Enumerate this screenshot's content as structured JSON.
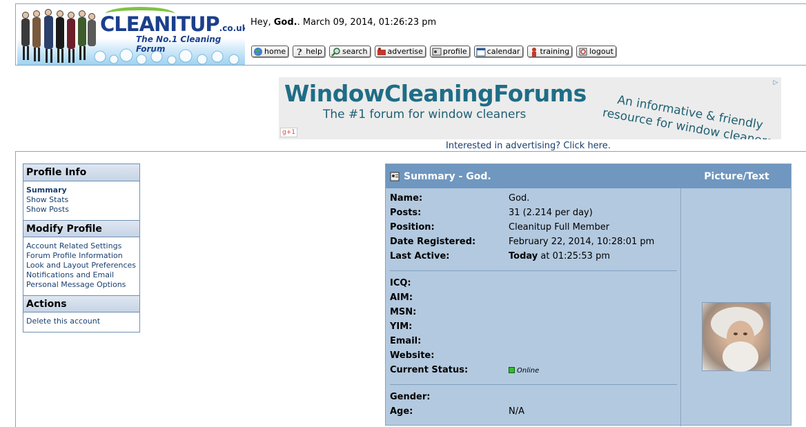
{
  "header": {
    "brand": "CLEANITUP",
    "brand_tld": ".co.uk",
    "tagline": "The No.1 Cleaning Forum",
    "greeting_prefix": "Hey, ",
    "username": "God.",
    "greeting_suffix": ". March 09, 2014, 01:26:23 pm"
  },
  "nav": [
    {
      "label": "home",
      "icon": "globe-icon"
    },
    {
      "label": "help",
      "icon": "question-icon"
    },
    {
      "label": "search",
      "icon": "magnifier-icon"
    },
    {
      "label": "advertise",
      "icon": "advertise-icon"
    },
    {
      "label": "profile",
      "icon": "profile-icon"
    },
    {
      "label": "calendar",
      "icon": "calendar-icon"
    },
    {
      "label": "training",
      "icon": "training-icon"
    },
    {
      "label": "logout",
      "icon": "logout-icon"
    }
  ],
  "ad": {
    "title": "WindowCleaningForums",
    "subtitle": "The #1 forum for window cleaners",
    "tagline": "An informative & friendly resource for window cleaners",
    "gplus": "g+1",
    "link": "Interested in advertising? Click here."
  },
  "menu": {
    "profile_info": {
      "title": "Profile Info",
      "items": [
        "Summary",
        "Show Stats",
        "Show Posts"
      ]
    },
    "modify_profile": {
      "title": "Modify Profile",
      "items": [
        "Account Related Settings",
        "Forum Profile Information",
        "Look and Layout Preferences",
        "Notifications and Email",
        "Personal Message Options"
      ]
    },
    "actions": {
      "title": "Actions",
      "items": [
        "Delete this account"
      ]
    }
  },
  "summary": {
    "title": "Summary - God.",
    "picture_header": "Picture/Text",
    "rows": {
      "name": {
        "label": "Name:",
        "value": "God."
      },
      "posts": {
        "label": "Posts:",
        "value": "31 (2.214 per day)"
      },
      "position": {
        "label": "Position:",
        "value": "Cleanitup Full Member"
      },
      "registered": {
        "label": "Date Registered:",
        "value": "February 22, 2014, 10:28:01 pm"
      },
      "last_active": {
        "label": "Last Active:",
        "value_bold": "Today",
        "value_rest": " at 01:25:53 pm"
      },
      "icq": {
        "label": "ICQ:"
      },
      "aim": {
        "label": "AIM:"
      },
      "msn": {
        "label": "MSN:"
      },
      "yim": {
        "label": "YIM:"
      },
      "email": {
        "label": "Email:"
      },
      "website": {
        "label": "Website:"
      },
      "status": {
        "label": "Current Status:",
        "value": "Online"
      },
      "gender": {
        "label": "Gender:"
      },
      "age": {
        "label": "Age:",
        "value": "N/A"
      }
    }
  }
}
